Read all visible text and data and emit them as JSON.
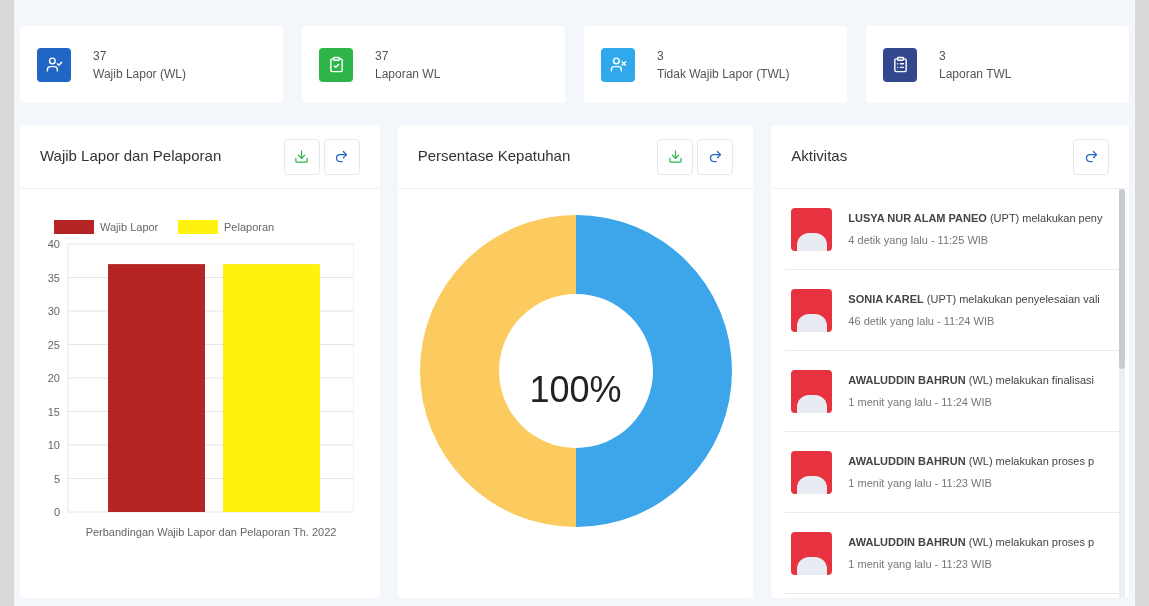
{
  "stats": [
    {
      "value": "37",
      "label": "Wajib Lapor (WL)",
      "kind": "user-check",
      "color": "#2166c4"
    },
    {
      "value": "37",
      "label": "Laporan WL",
      "kind": "clipboard-check",
      "color": "#2db54a"
    },
    {
      "value": "3",
      "label": "Tidak Wajib Lapor (TWL)",
      "kind": "user-x",
      "color": "#2fa8ec"
    },
    {
      "value": "3",
      "label": "Laporan TWL",
      "kind": "clipboard-chart",
      "color": "#33478e"
    }
  ],
  "bar_panel": {
    "title": "Wajib Lapor dan Pelaporan",
    "chart_data": {
      "type": "bar",
      "grid": true,
      "legend": true,
      "categories": [
        "Perbandingan Wajib Lapor dan Pelaporan Th. 2022"
      ],
      "series": [
        {
          "name": "Wajib Lapor",
          "color": "#b52525",
          "values": [
            37
          ]
        },
        {
          "name": "Pelaporan",
          "color": "#fff20f",
          "values": [
            37
          ]
        }
      ],
      "ylim": [
        0,
        40
      ],
      "yticks": [
        0,
        5,
        10,
        15,
        20,
        25,
        30,
        35,
        40
      ]
    }
  },
  "donut_panel": {
    "title": "Persentase Kepatuhan",
    "center_label": "100%"
  },
  "activity_panel": {
    "title": "Aktivitas",
    "items": [
      {
        "text": "**LUSYA NUR ALAM PANEO** (UPT) melakukan peny",
        "time": "4 detik yang lalu - 11:25 WIB"
      },
      {
        "text": "**SONIA KAREL** (UPT) melakukan penyelesaian vali",
        "time": "46 detik yang lalu - 11:24 WIB"
      },
      {
        "text": "**AWALUDDIN BAHRUN** (WL) melakukan finalisasi",
        "time": "1 menit yang lalu - 11:24 WIB"
      },
      {
        "text": "**AWALUDDIN BAHRUN** (WL) melakukan proses p",
        "time": "1 menit yang lalu - 11:23 WIB"
      },
      {
        "text": "**AWALUDDIN BAHRUN** (WL) melakukan proses p",
        "time": "1 menit yang lalu - 11:23 WIB"
      }
    ]
  }
}
